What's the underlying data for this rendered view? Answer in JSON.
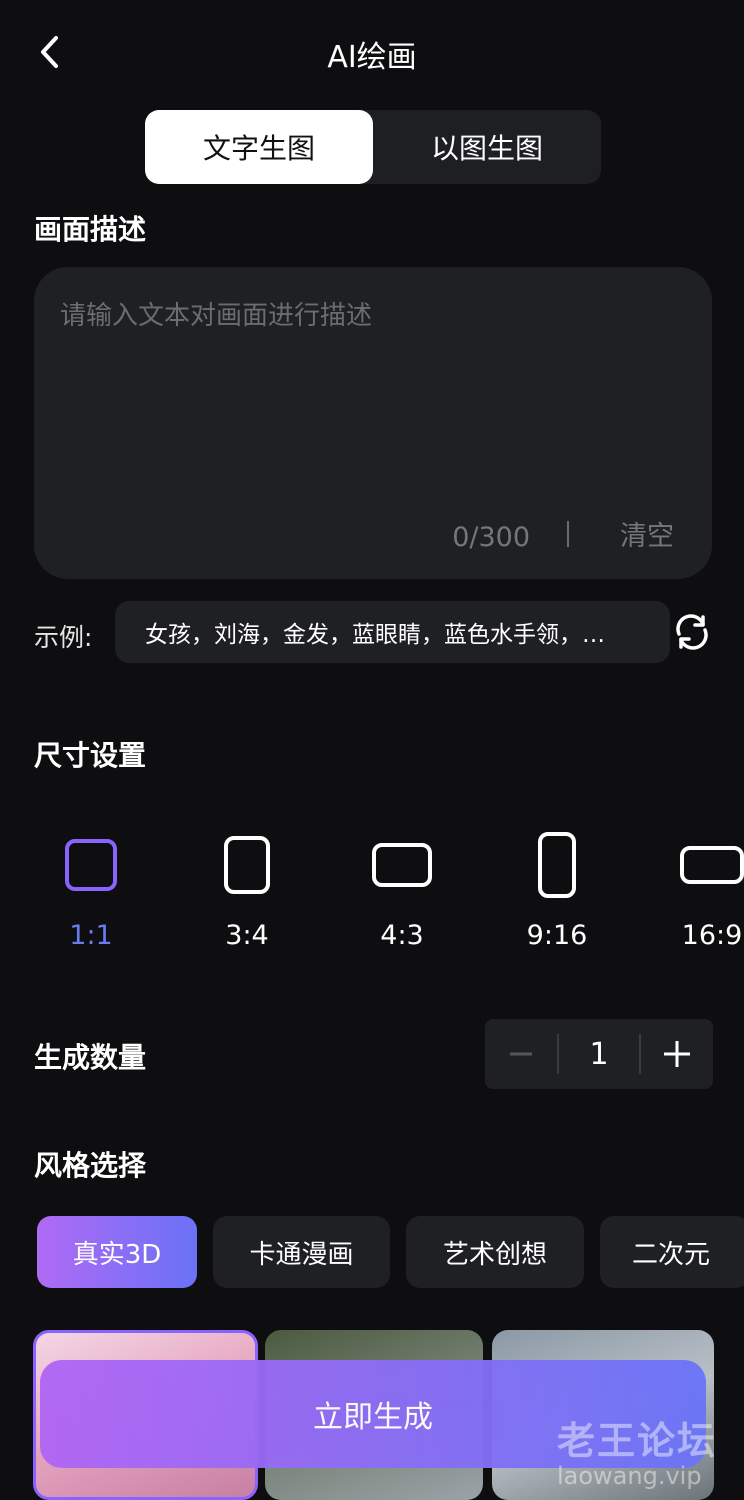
{
  "header": {
    "title": "AI绘画"
  },
  "tabs": [
    {
      "label": "文字生图",
      "active": true
    },
    {
      "label": "以图生图",
      "active": false
    }
  ],
  "description": {
    "section_label": "画面描述",
    "placeholder": "请输入文本对画面进行描述",
    "counter": "0/300",
    "clear_label": "清空"
  },
  "example": {
    "label": "示例:",
    "text": "女孩，刘海，金发，蓝眼睛，蓝色水手领，…"
  },
  "size": {
    "section_label": "尺寸设置",
    "options": [
      {
        "label": "1:1",
        "selected": true
      },
      {
        "label": "3:4",
        "selected": false
      },
      {
        "label": "4:3",
        "selected": false
      },
      {
        "label": "9:16",
        "selected": false
      },
      {
        "label": "16:9",
        "selected": false
      }
    ]
  },
  "quantity": {
    "section_label": "生成数量",
    "value": "1"
  },
  "style": {
    "section_label": "风格选择",
    "chips": [
      {
        "label": "真实3D",
        "active": true
      },
      {
        "label": "卡通漫画",
        "active": false
      },
      {
        "label": "艺术创想",
        "active": false
      },
      {
        "label": "二次元",
        "active": false
      }
    ]
  },
  "generate_button": "立即生成",
  "watermark": {
    "line1": "老王论坛",
    "line2": "laowang.vip"
  },
  "colors": {
    "accent_start": "#b065f4",
    "accent_end": "#6a74f6",
    "selected_ratio": "#8a63ff"
  }
}
